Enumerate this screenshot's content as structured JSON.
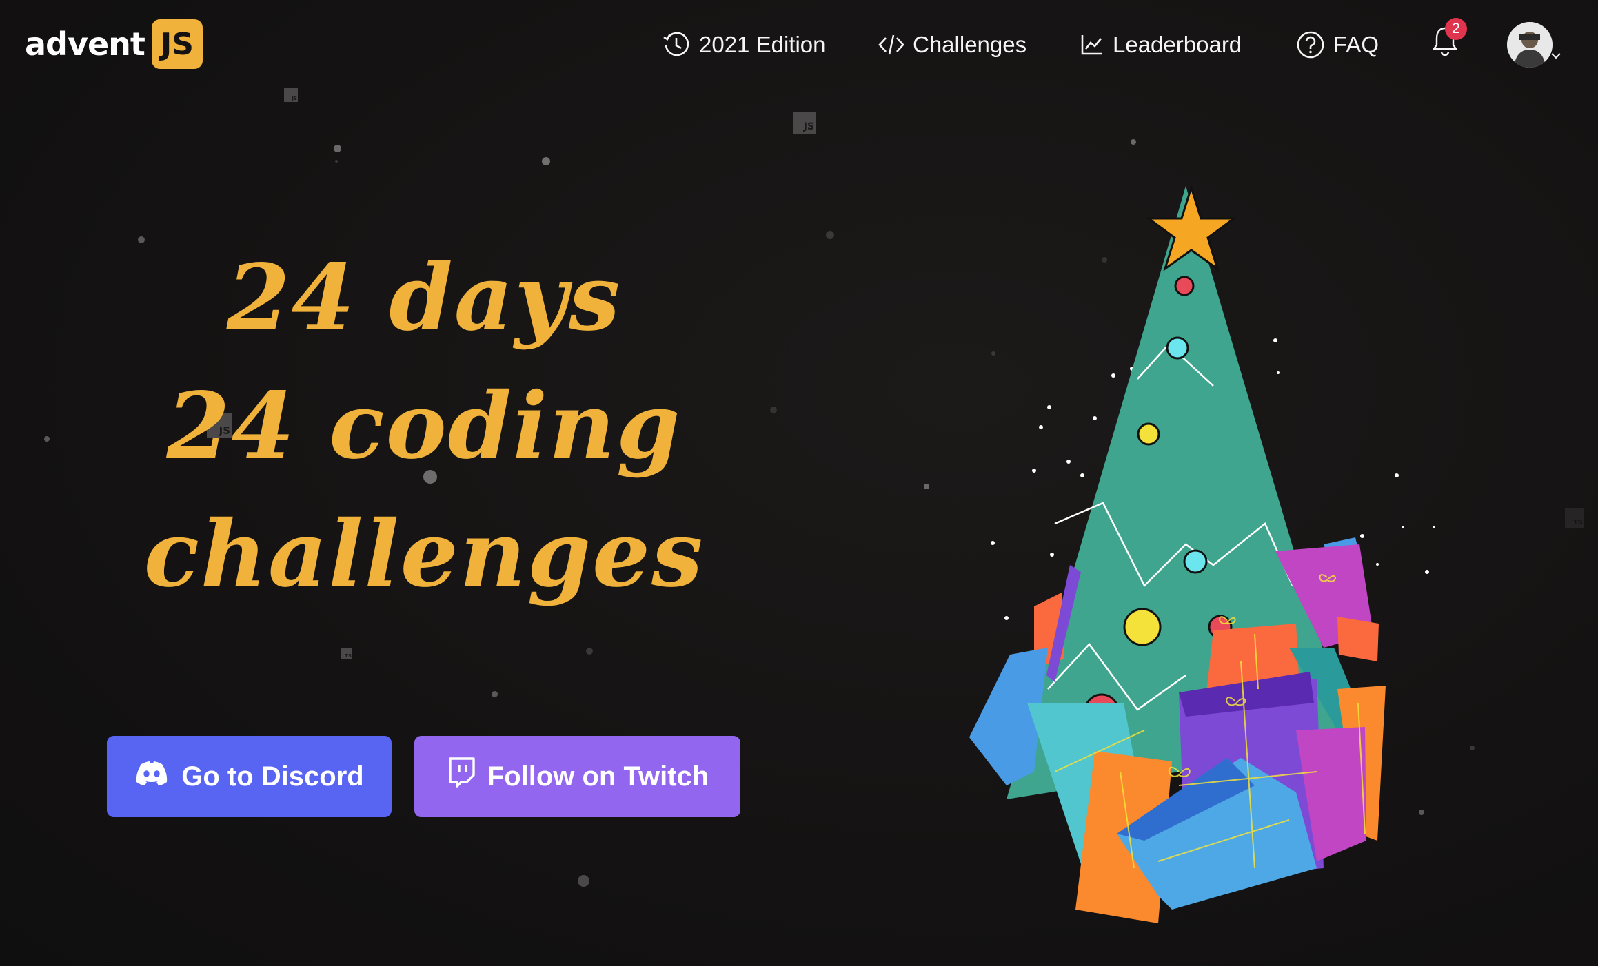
{
  "brand": {
    "word": "advent",
    "badge": "JS",
    "accent_color": "#f0b23a"
  },
  "nav": {
    "items": [
      {
        "label": "2021 Edition",
        "icon": "clock-history-icon"
      },
      {
        "label": "Challenges",
        "icon": "code-icon"
      },
      {
        "label": "Leaderboard",
        "icon": "chart-line-icon"
      },
      {
        "label": "FAQ",
        "icon": "question-circle-icon"
      }
    ],
    "notifications": {
      "icon": "bell-icon",
      "count": "2"
    },
    "user": {
      "icon": "avatar",
      "menu_icon": "chevron-down-icon"
    }
  },
  "hero": {
    "line1": "24 days",
    "line2": "24 coding",
    "line3": "challenges"
  },
  "buttons": {
    "discord": {
      "label": "Go to Discord",
      "icon": "discord-icon",
      "color": "#5865f2"
    },
    "twitch": {
      "label": "Follow on Twitch",
      "icon": "twitch-icon",
      "color": "#9366f0"
    }
  },
  "illustration": {
    "name": "christmas-tree-with-gifts",
    "tree_color": "#3fa58f",
    "star_color": "#f5a623"
  }
}
